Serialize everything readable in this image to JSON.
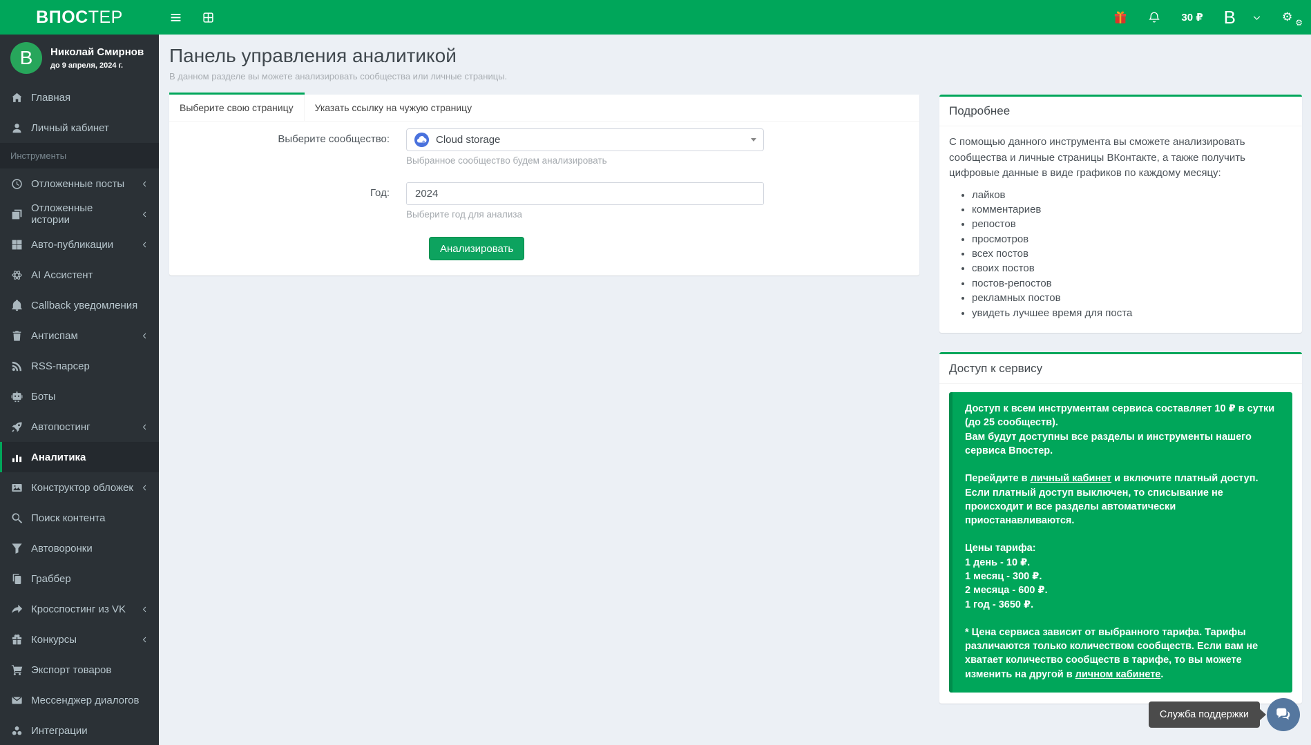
{
  "brand": {
    "logo_bold": "ВПОС",
    "logo_light": "ТЕР"
  },
  "topbar": {
    "balance": "30 ₽",
    "avatar_letter": "B",
    "icons": [
      "menu-icon",
      "grid-icon",
      "gift-icon",
      "bell-icon",
      "chevron-down-icon",
      "gears-icon"
    ]
  },
  "sidebar": {
    "user": {
      "name": "Николай Смирнов",
      "until": "до 9 апреля, 2024 г.",
      "avatar_letter": "B"
    },
    "section_label": "Инструменты",
    "items": [
      {
        "label": "Главная",
        "icon": "home-icon"
      },
      {
        "label": "Личный кабинет",
        "icon": "user-icon"
      },
      {
        "label": "Отложенные посты",
        "icon": "clock-icon"
      },
      {
        "label": "Отложенные истории",
        "icon": "stories-icon"
      },
      {
        "label": "Авто-публикации",
        "icon": "grid-icon"
      },
      {
        "label": "AI Ассистент",
        "icon": "ai-icon"
      },
      {
        "label": "Callback уведомления",
        "icon": "bell-icon"
      },
      {
        "label": "Антиспам",
        "icon": "trash-icon"
      },
      {
        "label": "RSS-парсер",
        "icon": "rss-icon"
      },
      {
        "label": "Боты",
        "icon": "robot-icon"
      },
      {
        "label": "Автопостинг",
        "icon": "rocket-icon"
      },
      {
        "label": "Аналитика",
        "icon": "bar-chart-icon"
      },
      {
        "label": "Конструктор обложек",
        "icon": "image-icon"
      },
      {
        "label": "Поиск контента",
        "icon": "search-icon"
      },
      {
        "label": "Автоворонки",
        "icon": "funnel-icon"
      },
      {
        "label": "Граббер",
        "icon": "copy-icon"
      },
      {
        "label": "Кросспостинг из VK",
        "icon": "share-icon"
      },
      {
        "label": "Конкурсы",
        "icon": "gift-icon"
      },
      {
        "label": "Экспорт товаров",
        "icon": "cart-icon"
      },
      {
        "label": "Мессенджер диалогов",
        "icon": "envelope-icon"
      },
      {
        "label": "Интеграции",
        "icon": "integrations-icon"
      }
    ]
  },
  "main": {
    "title": "Панель управления аналитикой",
    "subtitle": "В данном разделе вы можете анализировать сообщества или личные страницы.",
    "tabs": [
      {
        "label": "Выберите свою страницу"
      },
      {
        "label": "Указать ссылку на чужую страницу"
      }
    ],
    "form": {
      "community_label": "Выберите сообщество:",
      "community_value": "Cloud storage",
      "community_help": "Выбранное сообщество будем анализировать",
      "year_label": "Год:",
      "year_value": "2024",
      "year_help": "Выберите год для анализа",
      "submit_label": "Анализировать"
    }
  },
  "details": {
    "title": "Подробнее",
    "intro": "С помощью данного инструмента вы сможете анализировать сообщества и личные страницы ВКонтакте, а также получить цифровые данные в виде графиков по каждому месяцу:",
    "bullets": [
      "лайков",
      "комментариев",
      "репостов",
      "просмотров",
      "всех постов",
      "своих постов",
      "постов-репостов",
      "рекламных постов",
      "увидеть лучшее время для поста"
    ]
  },
  "access": {
    "title": "Доступ к сервису",
    "p1a": "Доступ к всем инструментам сервиса составляет 10 ₽ в сутки (до 25 сообществ).",
    "p1b": "Вам будут доступны все разделы и инструменты нашего сервиса Впостер.",
    "p2_pre": "Перейдите в ",
    "p2_link": "личный кабинет",
    "p2_post": " и включите платный доступ. Если платный доступ выключен, то списывание не происходит и все разделы автоматически приостанавливаются.",
    "prices_title": "Цены тарифа:",
    "prices": [
      "1 день - 10 ₽.",
      "1 месяц - 300 ₽.",
      "2 месяца - 600 ₽.",
      "1 год - 3650 ₽."
    ],
    "note_pre": "* Цена сервиса зависит от выбранного тарифа. Тарифы различаются только количеством сообществ. Если вам не хватает количество сообществ в тарифе, то вы можете изменить на другой в ",
    "note_link": "личном кабинете",
    "note_post": "."
  },
  "support": {
    "tooltip": "Служба поддержки"
  },
  "colors": {
    "accent_green": "#00a65a",
    "accent_green_dark": "#008d4c",
    "sidebar_bg": "#2b3136",
    "page_bg": "#ecf0f5",
    "support_blue": "#55779f",
    "gift_red": "#d9342b"
  }
}
